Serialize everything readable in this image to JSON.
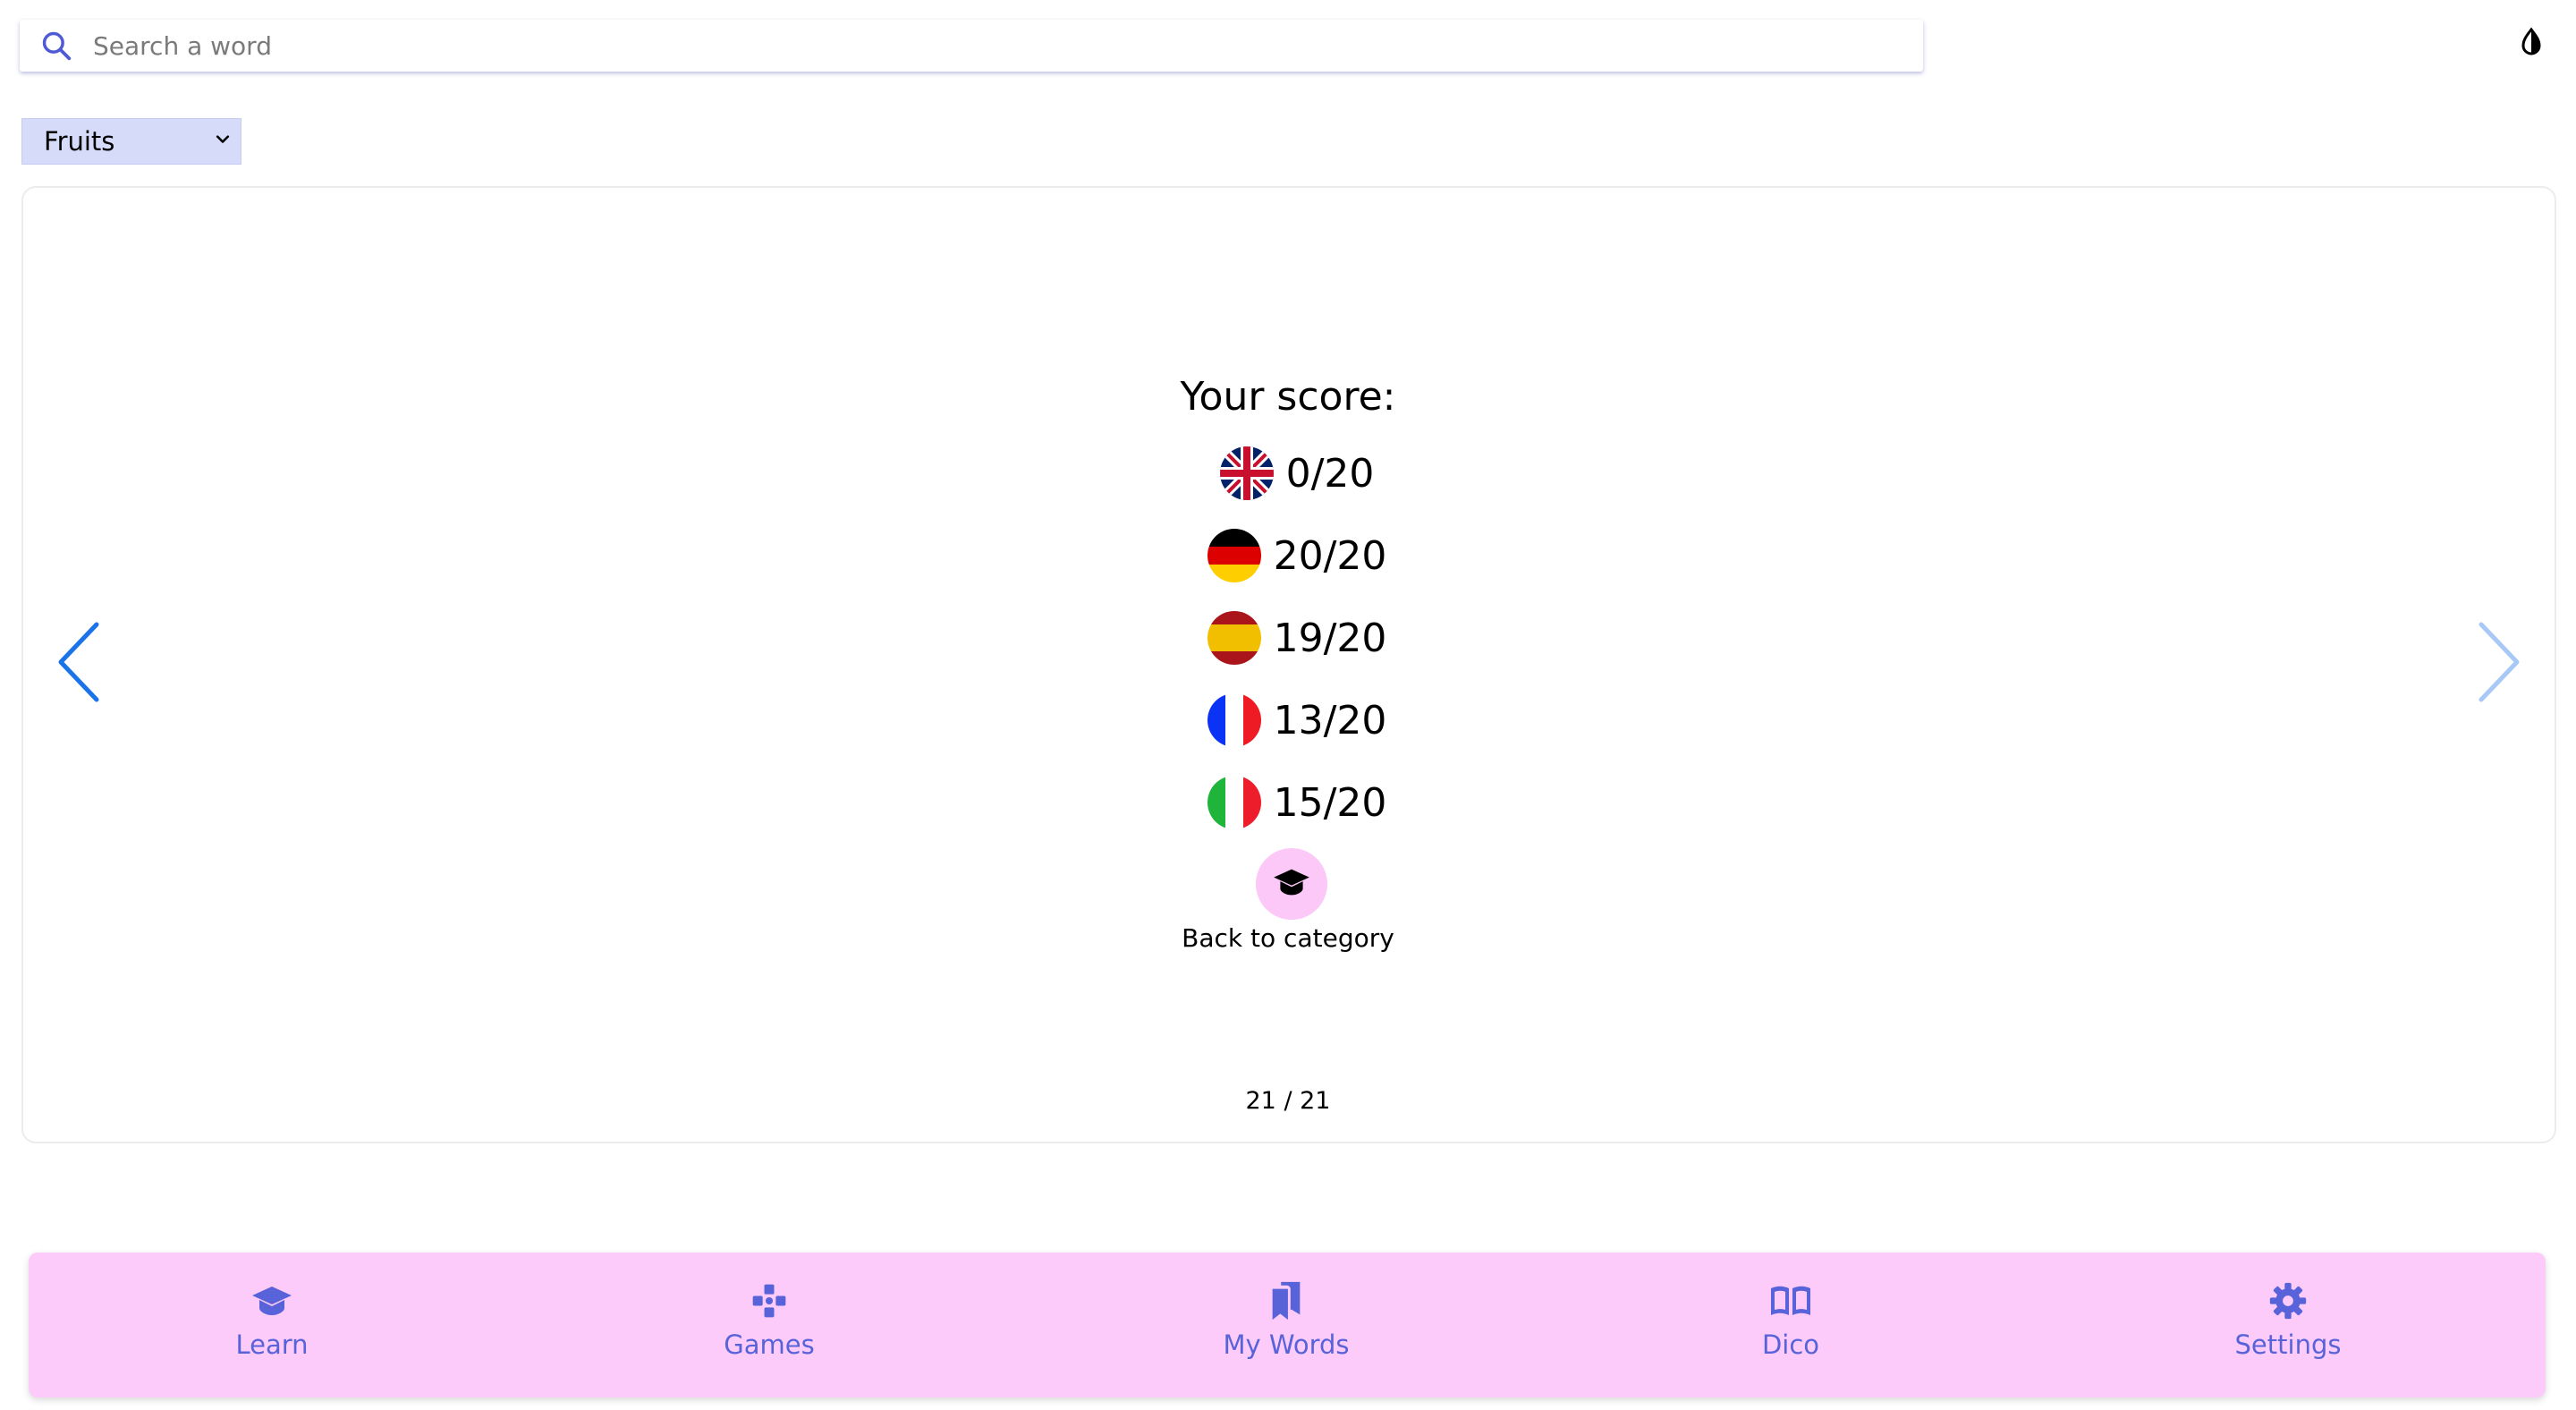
{
  "search": {
    "placeholder": "Search a word"
  },
  "category": {
    "selected": "Fruits"
  },
  "card": {
    "score_title": "Your score:",
    "scores": [
      {
        "flag": "uk-flag-icon",
        "value": "0/20"
      },
      {
        "flag": "germany-flag-icon",
        "value": "20/20"
      },
      {
        "flag": "spain-flag-icon",
        "value": "19/20"
      },
      {
        "flag": "france-flag-icon",
        "value": "13/20"
      },
      {
        "flag": "italy-flag-icon",
        "value": "15/20"
      }
    ],
    "back_label": "Back to category",
    "counter": "21 / 21"
  },
  "bottom_nav": {
    "items": [
      {
        "label": "Learn",
        "icon": "graduation-cap-icon"
      },
      {
        "label": "Games",
        "icon": "gamepad-icon"
      },
      {
        "label": "My Words",
        "icon": "bookmarks-icon"
      },
      {
        "label": "Dico",
        "icon": "open-book-icon"
      },
      {
        "label": "Settings",
        "icon": "gear-icon"
      }
    ]
  },
  "colors": {
    "accent": "#5863d9",
    "nav_background": "#fccbf9",
    "select_background": "#d5dbf8",
    "arrow_active": "#1a73e8",
    "arrow_inactive": "#a8c8f8"
  }
}
